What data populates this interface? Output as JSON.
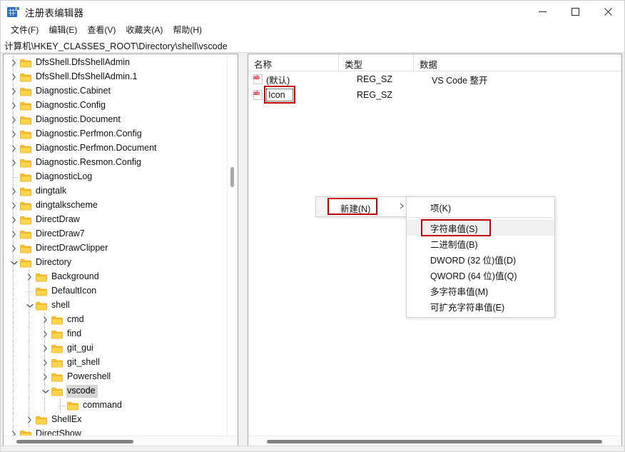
{
  "window": {
    "title": "注册表编辑器",
    "icon": "registry-editor-icon",
    "minimize_label": "最小化",
    "maximize_label": "最大化",
    "close_label": "关闭"
  },
  "menubar": {
    "items": [
      {
        "label": "文件(F)",
        "name": "menu-file"
      },
      {
        "label": "编辑(E)",
        "name": "menu-edit"
      },
      {
        "label": "查看(V)",
        "name": "menu-view"
      },
      {
        "label": "收藏夹(A)",
        "name": "menu-favorites"
      },
      {
        "label": "帮助(H)",
        "name": "menu-help"
      }
    ]
  },
  "address": {
    "path": "计算机\\HKEY_CLASSES_ROOT\\Directory\\shell\\vscode"
  },
  "tree": {
    "nodes": [
      {
        "label": "DfsShell.DfsShellAdmin",
        "depth": 1,
        "twisty": "collapsed",
        "selected": false
      },
      {
        "label": "DfsShell.DfsShellAdmin.1",
        "depth": 1,
        "twisty": "collapsed",
        "selected": false
      },
      {
        "label": "Diagnostic.Cabinet",
        "depth": 1,
        "twisty": "collapsed",
        "selected": false
      },
      {
        "label": "Diagnostic.Config",
        "depth": 1,
        "twisty": "collapsed",
        "selected": false
      },
      {
        "label": "Diagnostic.Document",
        "depth": 1,
        "twisty": "collapsed",
        "selected": false
      },
      {
        "label": "Diagnostic.Perfmon.Config",
        "depth": 1,
        "twisty": "collapsed",
        "selected": false
      },
      {
        "label": "Diagnostic.Perfmon.Document",
        "depth": 1,
        "twisty": "collapsed",
        "selected": false
      },
      {
        "label": "Diagnostic.Resmon.Config",
        "depth": 1,
        "twisty": "collapsed",
        "selected": false
      },
      {
        "label": "DiagnosticLog",
        "depth": 1,
        "twisty": "none",
        "selected": false
      },
      {
        "label": "dingtalk",
        "depth": 1,
        "twisty": "collapsed",
        "selected": false
      },
      {
        "label": "dingtalkscheme",
        "depth": 1,
        "twisty": "collapsed",
        "selected": false
      },
      {
        "label": "DirectDraw",
        "depth": 1,
        "twisty": "collapsed",
        "selected": false
      },
      {
        "label": "DirectDraw7",
        "depth": 1,
        "twisty": "collapsed",
        "selected": false
      },
      {
        "label": "DirectDrawClipper",
        "depth": 1,
        "twisty": "collapsed",
        "selected": false
      },
      {
        "label": "Directory",
        "depth": 1,
        "twisty": "expanded",
        "selected": false
      },
      {
        "label": "Background",
        "depth": 2,
        "twisty": "collapsed",
        "selected": false
      },
      {
        "label": "DefaultIcon",
        "depth": 2,
        "twisty": "none",
        "selected": false
      },
      {
        "label": "shell",
        "depth": 2,
        "twisty": "expanded",
        "selected": false
      },
      {
        "label": "cmd",
        "depth": 3,
        "twisty": "collapsed",
        "selected": false
      },
      {
        "label": "find",
        "depth": 3,
        "twisty": "collapsed",
        "selected": false
      },
      {
        "label": "git_gui",
        "depth": 3,
        "twisty": "collapsed",
        "selected": false
      },
      {
        "label": "git_shell",
        "depth": 3,
        "twisty": "collapsed",
        "selected": false
      },
      {
        "label": "Powershell",
        "depth": 3,
        "twisty": "collapsed",
        "selected": false
      },
      {
        "label": "vscode",
        "depth": 3,
        "twisty": "expanded",
        "selected": true
      },
      {
        "label": "command",
        "depth": 4,
        "twisty": "none",
        "selected": false
      },
      {
        "label": "ShellEx",
        "depth": 2,
        "twisty": "collapsed",
        "selected": false
      },
      {
        "label": "DirectShow",
        "depth": 1,
        "twisty": "collapsed",
        "selected": false
      }
    ]
  },
  "list": {
    "columns": [
      {
        "label": "名称",
        "name": "column-name"
      },
      {
        "label": "类型",
        "name": "column-type"
      },
      {
        "label": "数据",
        "name": "column-data"
      }
    ],
    "rows": [
      {
        "name": "(默认)",
        "type": "REG_SZ",
        "data": "VS Code 整开",
        "editing": false
      },
      {
        "name": "Icon",
        "type": "REG_SZ",
        "data": "",
        "editing": true
      }
    ]
  },
  "context_menu": {
    "parent": {
      "label": "新建(N)",
      "submenu_arrow": "chevron-right-icon"
    },
    "submenu": [
      {
        "label": "项(K)",
        "hovered": false,
        "separator_after": true
      },
      {
        "label": "字符串值(S)",
        "hovered": true,
        "separator_after": false
      },
      {
        "label": "二进制值(B)",
        "hovered": false,
        "separator_after": false
      },
      {
        "label": "DWORD (32 位)值(D)",
        "hovered": false,
        "separator_after": false
      },
      {
        "label": "QWORD (64 位)值(Q)",
        "hovered": false,
        "separator_after": false
      },
      {
        "label": "多字符串值(M)",
        "hovered": false,
        "separator_after": false
      },
      {
        "label": "可扩充字符串值(E)",
        "hovered": false,
        "separator_after": false
      }
    ]
  },
  "annotations": {
    "highlight_color": "#c00000",
    "boxes": [
      {
        "target": "icon-value-name"
      },
      {
        "target": "new-menu-item"
      },
      {
        "target": "string-value-menu-item"
      }
    ]
  },
  "colors": {
    "folder": "#fdc12e",
    "selection": "#d5d5d5",
    "accent": "#2c6fc4"
  }
}
